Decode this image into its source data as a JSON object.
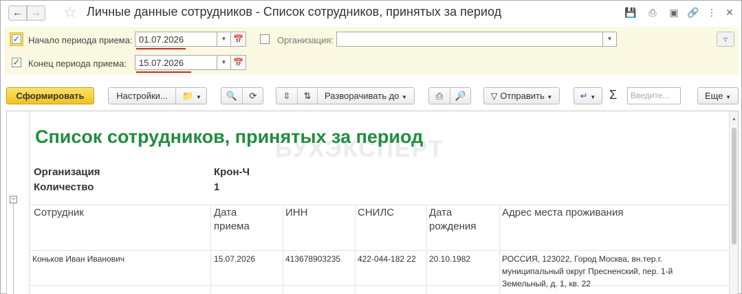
{
  "window": {
    "title": "Личные данные сотрудников - Список сотрудников, принятых за период",
    "icons": [
      "save-icon",
      "print-icon",
      "external-icon",
      "link-icon",
      "more-icon",
      "close-icon"
    ]
  },
  "filter": {
    "start": {
      "checked": true,
      "label": "Начало периода приема:",
      "value": "01.07.2026"
    },
    "end": {
      "checked": true,
      "label": "Конец периода приема:",
      "value": "15.07.2026"
    },
    "org": {
      "checked": false,
      "label": "Организация:",
      "value": ""
    }
  },
  "toolbar": {
    "generate": "Сформировать",
    "settings": "Настройки...",
    "expand": "Разворачивать до",
    "send": "Отправить",
    "search_placeholder": "Введите...",
    "more": "Еще"
  },
  "report": {
    "title": "Список сотрудников, принятых за период",
    "watermark": "БУХЭКСПЕРТ",
    "meta": [
      {
        "label": "Организация",
        "value": "Крон-Ч"
      },
      {
        "label": "Количество",
        "value": "1"
      }
    ],
    "columns": {
      "employee": "Сотрудник",
      "hire_date_1": "Дата",
      "hire_date_2": "приема",
      "inn": "ИНН",
      "snils": "СНИЛС",
      "birth_1": "Дата",
      "birth_2": "рождения",
      "address": "Адрес места проживания"
    },
    "rows": [
      {
        "employee": "Коньков Иван Иванович",
        "hire_date": "15.07.2026",
        "inn": "413678903235",
        "snils": "422-044-182 22",
        "birth_date": "20.10.1982",
        "address_1": "РОССИЯ, 123022, Город Москва, вн.тер.г.",
        "address_2": "муниципальный округ Пресненский, пер. 1-й",
        "address_3": "Земельный, д. 1, кв. 22"
      }
    ]
  },
  "colors": {
    "accent": "#f3c21a",
    "report_title": "#1e8f3c",
    "underline": "#d9221f",
    "filter_bg": "#fbf9e1"
  }
}
